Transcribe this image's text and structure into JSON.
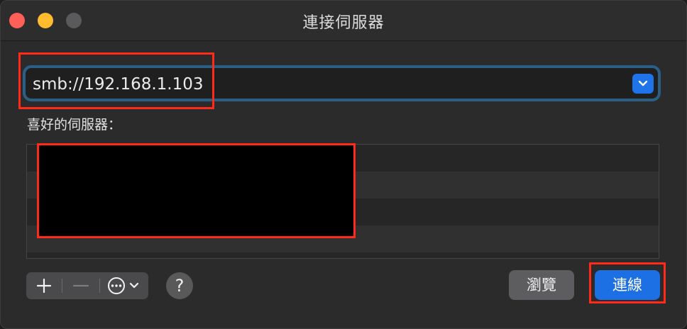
{
  "window": {
    "title": "連接伺服器"
  },
  "address": {
    "value": "smb://192.168.1.103"
  },
  "favorites": {
    "label": "喜好的伺服器："
  },
  "toolbar": {
    "add_label": "+",
    "remove_label": "—",
    "help_label": "?"
  },
  "buttons": {
    "browse_label": "瀏覽",
    "connect_label": "連線"
  },
  "colors": {
    "accent": "#1d6fe4",
    "focus_ring": "#2b5f86",
    "annotation_red": "#ff2a1a"
  }
}
